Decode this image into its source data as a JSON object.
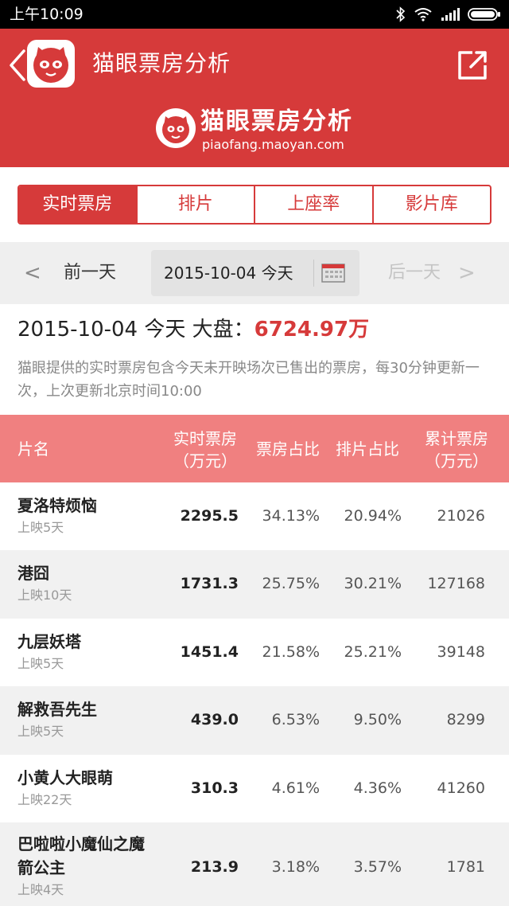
{
  "status_bar": {
    "time": "上午10:09"
  },
  "app": {
    "title": "猫眼票房分析"
  },
  "banner": {
    "name": "猫眼票房分析",
    "url": "piaofang.maoyan.com"
  },
  "tabs": [
    {
      "label": "实时票房",
      "active": true
    },
    {
      "label": "排片",
      "active": false
    },
    {
      "label": "上座率",
      "active": false
    },
    {
      "label": "影片库",
      "active": false
    }
  ],
  "date_nav": {
    "prev_label": "前一天",
    "current_date": "2015-10-04 今天",
    "next_label": "后一天"
  },
  "summary": {
    "heading": "2015-10-04 今天 大盘：",
    "total": "6724.97万",
    "note": "猫眼提供的实时票房包含今天未开映场次已售出的票房，每30分钟更新一次，上次更新北京时间10:00"
  },
  "table": {
    "headers": {
      "name": "片名",
      "realtime_line1": "实时票房",
      "realtime_line2": "（万元）",
      "box_share": "票房占比",
      "screen_share": "排片占比",
      "cumulative_line1": "累计票房",
      "cumulative_line2": "（万元）"
    },
    "rows": [
      {
        "title": "夏洛特烦恼",
        "release": "上映5天",
        "realtime": "2295.5",
        "box_share": "34.13%",
        "screen_share": "20.94%",
        "cumulative": "21026"
      },
      {
        "title": "港囧",
        "release": "上映10天",
        "realtime": "1731.3",
        "box_share": "25.75%",
        "screen_share": "30.21%",
        "cumulative": "127168"
      },
      {
        "title": "九层妖塔",
        "release": "上映5天",
        "realtime": "1451.4",
        "box_share": "21.58%",
        "screen_share": "25.21%",
        "cumulative": "39148"
      },
      {
        "title": "解救吾先生",
        "release": "上映5天",
        "realtime": "439.0",
        "box_share": "6.53%",
        "screen_share": "9.50%",
        "cumulative": "8299"
      },
      {
        "title": "小黄人大眼萌",
        "release": "上映22天",
        "realtime": "310.3",
        "box_share": "4.61%",
        "screen_share": "4.36%",
        "cumulative": "41260"
      },
      {
        "title": "巴啦啦小魔仙之魔箭公主",
        "release": "上映4天",
        "realtime": "213.9",
        "box_share": "3.18%",
        "screen_share": "3.57%",
        "cumulative": "1781"
      }
    ]
  },
  "colors": {
    "brand": "#d63a3a",
    "header_row": "#f08080"
  }
}
